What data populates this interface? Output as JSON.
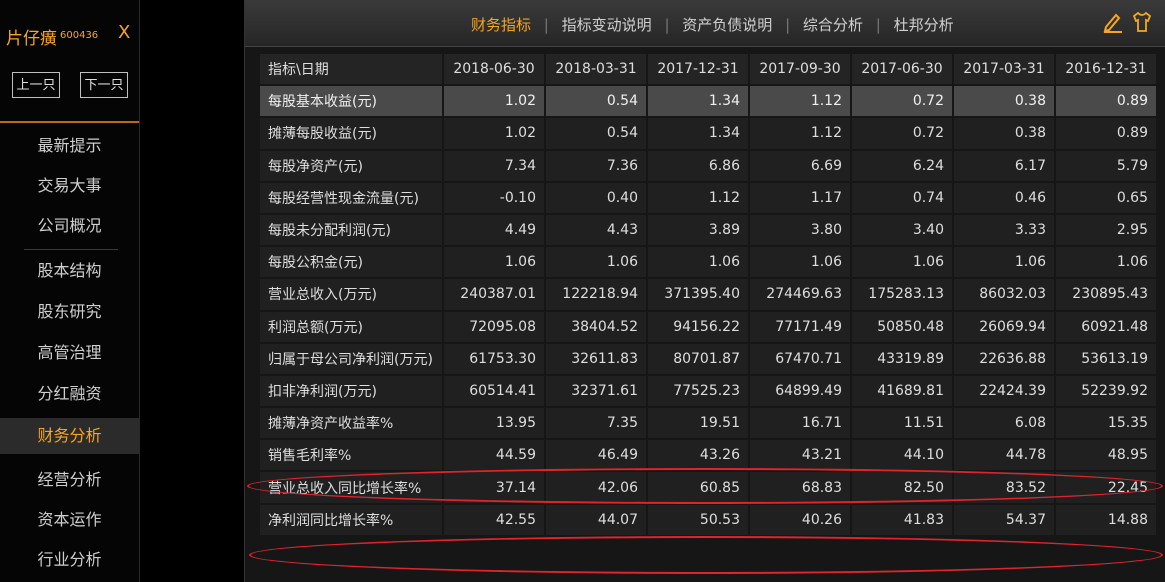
{
  "sidebar": {
    "stock_name": "片仔癀",
    "stock_code": "600436",
    "close_label": "X",
    "prev_label": "上一只",
    "next_label": "下一只",
    "menu": [
      {
        "label": "最新提示"
      },
      {
        "label": "交易大事"
      },
      {
        "label": "公司概况"
      },
      {
        "label": "股本结构"
      },
      {
        "label": "股东研究"
      },
      {
        "label": "高管治理"
      },
      {
        "label": "分红融资"
      },
      {
        "label": "财务分析"
      },
      {
        "label": "经营分析"
      },
      {
        "label": "资本运作"
      },
      {
        "label": "行业分析"
      }
    ],
    "active_menu": "财务分析"
  },
  "tabs": [
    {
      "label": "财务指标"
    },
    {
      "label": "指标变动说明"
    },
    {
      "label": "资产负债说明"
    },
    {
      "label": "综合分析"
    },
    {
      "label": "杜邦分析"
    }
  ],
  "active_tab": "财务指标",
  "toolbar_icons": [
    "pencil-icon",
    "shirt-icon"
  ],
  "table": {
    "corner": "指标\\日期",
    "columns": [
      "2018-06-30",
      "2018-03-31",
      "2017-12-31",
      "2017-09-30",
      "2017-06-30",
      "2017-03-31",
      "2016-12-31"
    ],
    "rows": [
      {
        "label": "每股基本收益(元)",
        "values": [
          "1.02",
          "0.54",
          "1.34",
          "1.12",
          "0.72",
          "0.38",
          "0.89"
        ]
      },
      {
        "label": "摊薄每股收益(元)",
        "values": [
          "1.02",
          "0.54",
          "1.34",
          "1.12",
          "0.72",
          "0.38",
          "0.89"
        ]
      },
      {
        "label": "每股净资产(元)",
        "values": [
          "7.34",
          "7.36",
          "6.86",
          "6.69",
          "6.24",
          "6.17",
          "5.79"
        ]
      },
      {
        "label": "每股经营性现金流量(元)",
        "values": [
          "-0.10",
          "0.40",
          "1.12",
          "1.17",
          "0.74",
          "0.46",
          "0.65"
        ]
      },
      {
        "label": "每股未分配利润(元)",
        "values": [
          "4.49",
          "4.43",
          "3.89",
          "3.80",
          "3.40",
          "3.33",
          "2.95"
        ]
      },
      {
        "label": "每股公积金(元)",
        "values": [
          "1.06",
          "1.06",
          "1.06",
          "1.06",
          "1.06",
          "1.06",
          "1.06"
        ]
      },
      {
        "label": "营业总收入(万元)",
        "values": [
          "240387.01",
          "122218.94",
          "371395.40",
          "274469.63",
          "175283.13",
          "86032.03",
          "230895.43"
        ]
      },
      {
        "label": "利润总额(万元)",
        "values": [
          "72095.08",
          "38404.52",
          "94156.22",
          "77171.49",
          "50850.48",
          "26069.94",
          "60921.48"
        ]
      },
      {
        "label": "归属于母公司净利润(万元)",
        "values": [
          "61753.30",
          "32611.83",
          "80701.87",
          "67470.71",
          "43319.89",
          "22636.88",
          "53613.19"
        ]
      },
      {
        "label": "扣非净利润(万元)",
        "values": [
          "60514.41",
          "32371.61",
          "77525.23",
          "64899.49",
          "41689.81",
          "22424.39",
          "52239.92"
        ]
      },
      {
        "label": "摊薄净资产收益率%",
        "values": [
          "13.95",
          "7.35",
          "19.51",
          "16.71",
          "11.51",
          "6.08",
          "15.35"
        ]
      },
      {
        "label": "销售毛利率%",
        "values": [
          "44.59",
          "46.49",
          "43.26",
          "43.21",
          "44.10",
          "44.78",
          "48.95"
        ]
      },
      {
        "label": "营业总收入同比增长率%",
        "values": [
          "37.14",
          "42.06",
          "60.85",
          "68.83",
          "82.50",
          "83.52",
          "22.45"
        ]
      },
      {
        "label": "净利润同比增长率%",
        "values": [
          "42.55",
          "44.07",
          "50.53",
          "40.26",
          "41.83",
          "54.37",
          "14.88"
        ]
      }
    ],
    "selected_row": "每股基本收益(元)"
  },
  "highlights": [
    "销售毛利率%",
    "净利润同比增长率%"
  ],
  "colors": {
    "accent": "#f5a623",
    "highlight": "#e0242c",
    "background": "#000000",
    "panel": "#161616"
  }
}
